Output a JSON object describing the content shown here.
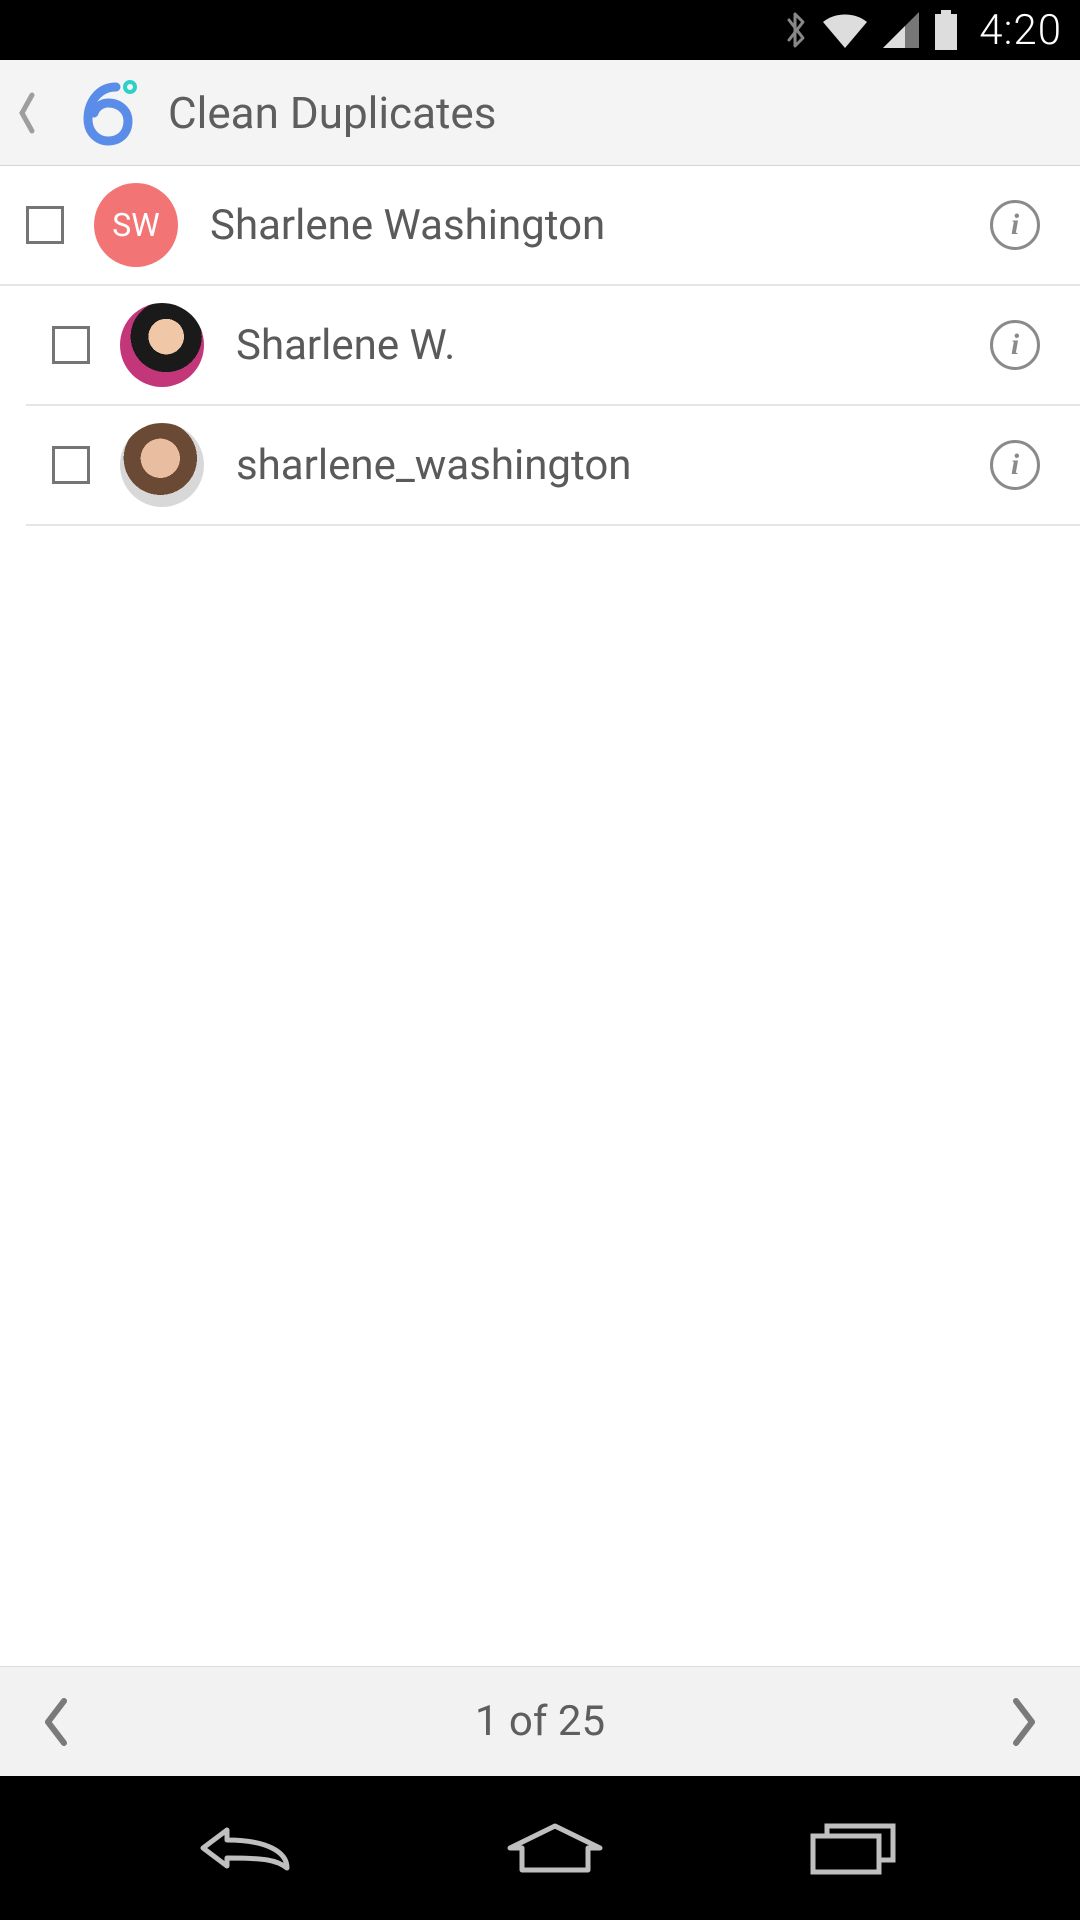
{
  "status": {
    "time": "4:20"
  },
  "appbar": {
    "title": "Clean Duplicates"
  },
  "contacts": [
    {
      "initials": "SW",
      "name": "Sharlene Washington",
      "avatarType": "initials"
    },
    {
      "initials": "",
      "name": "Sharlene W.",
      "avatarType": "photo1"
    },
    {
      "initials": "",
      "name": "sharlene_washington",
      "avatarType": "photo2"
    }
  ],
  "pager": {
    "label": "1 of 25"
  }
}
